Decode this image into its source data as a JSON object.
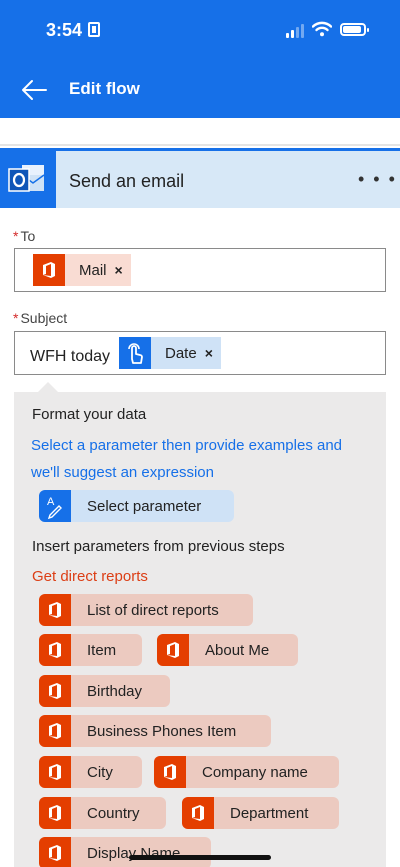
{
  "status": {
    "time": "3:54"
  },
  "header": {
    "title": "Edit flow"
  },
  "card": {
    "title": "Send an email",
    "more": "• • •"
  },
  "to": {
    "label": "To",
    "required_mark": "*",
    "token": "Mail",
    "remove": "×"
  },
  "subject": {
    "label": "Subject",
    "required_mark": "*",
    "text": "WFH today",
    "token": "Date",
    "remove": "×"
  },
  "panel": {
    "format_heading": "Format your data",
    "hint_line1": "Select a parameter then provide examples and",
    "hint_line2": "we'll suggest an expression",
    "select_parameter": "Select parameter",
    "insert_heading": "Insert parameters from previous steps",
    "source": "Get direct reports",
    "chips": [
      "List of direct reports",
      "Item",
      "About Me",
      "Birthday",
      "Business Phones Item",
      "City",
      "Company name",
      "Country",
      "Department",
      "Display Name"
    ]
  },
  "colors": {
    "brand_blue": "#1670e8",
    "office_orange": "#e43e00",
    "link_red": "#dc3e15"
  }
}
